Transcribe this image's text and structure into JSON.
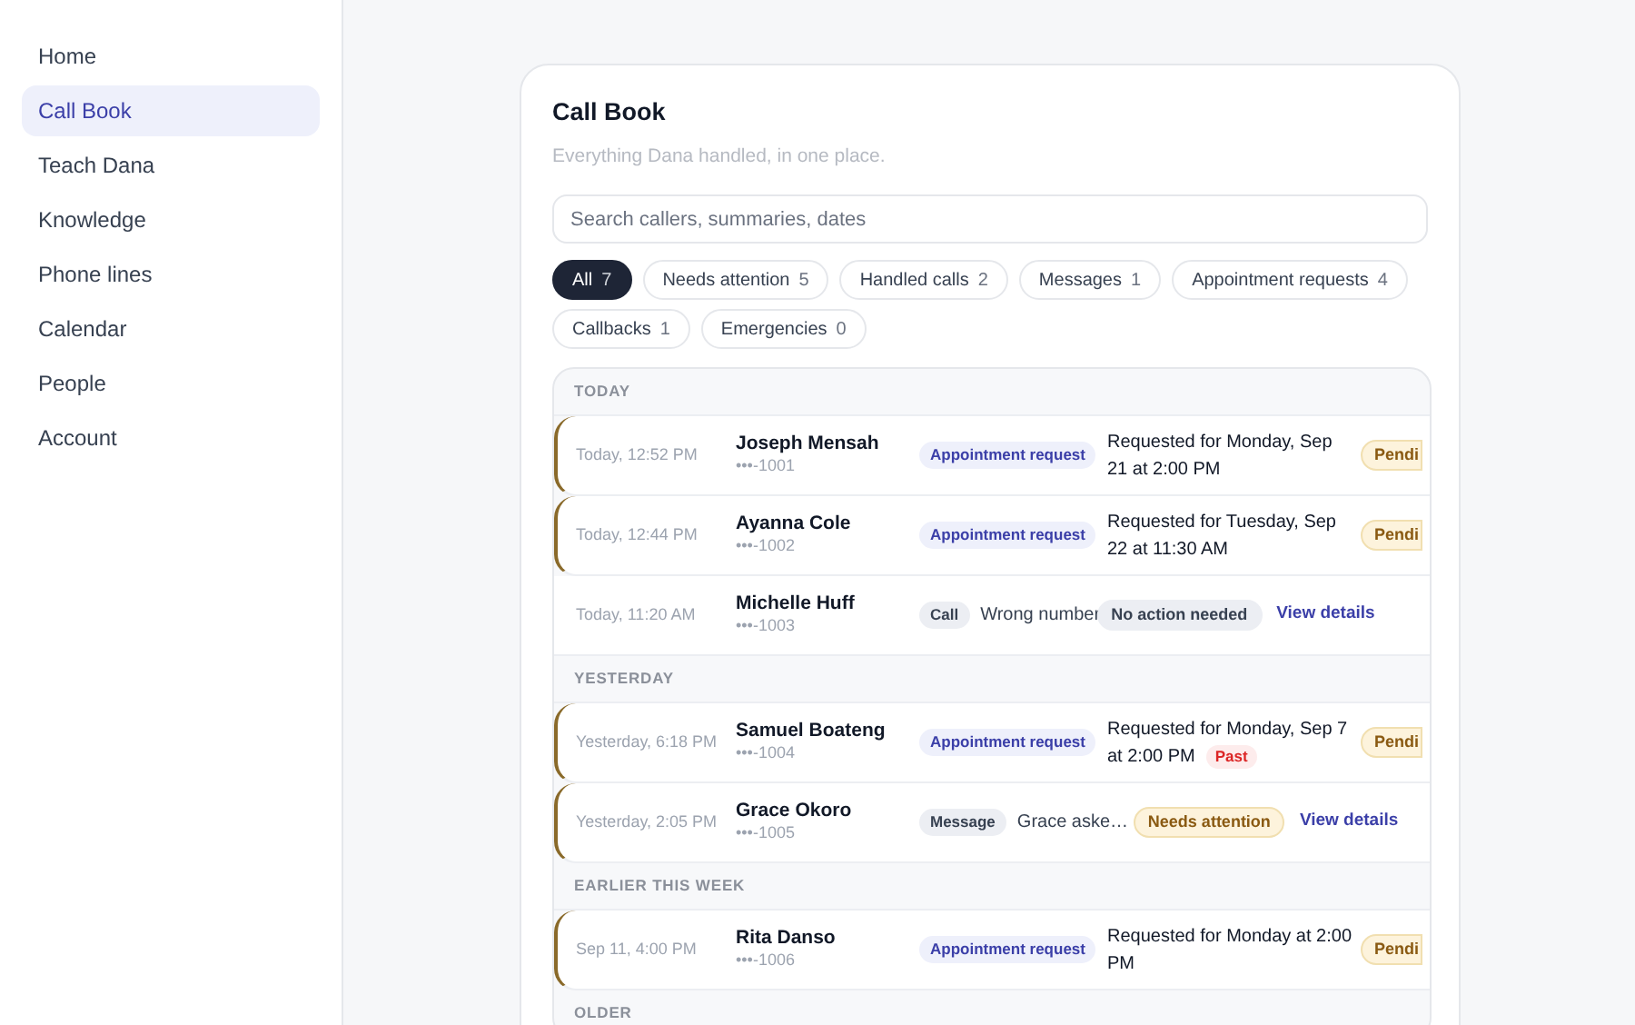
{
  "sidebar": {
    "items": [
      {
        "label": "Home",
        "selected": false
      },
      {
        "label": "Call Book",
        "selected": true
      },
      {
        "label": "Teach Dana",
        "selected": false
      },
      {
        "label": "Knowledge",
        "selected": false
      },
      {
        "label": "Phone lines",
        "selected": false
      },
      {
        "label": "Calendar",
        "selected": false
      },
      {
        "label": "People",
        "selected": false
      },
      {
        "label": "Account",
        "selected": false
      }
    ]
  },
  "page": {
    "title": "Call Book",
    "subtitle": "Everything Dana handled, in one place.",
    "search": {
      "placeholder": "Search callers, summaries, dates"
    }
  },
  "filters": [
    {
      "label": "All",
      "count": "7",
      "selected": true
    },
    {
      "label": "Needs attention",
      "count": "5",
      "selected": false
    },
    {
      "label": "Handled calls",
      "count": "2",
      "selected": false
    },
    {
      "label": "Messages",
      "count": "1",
      "selected": false
    },
    {
      "label": "Appointment requests",
      "count": "4",
      "selected": false
    },
    {
      "label": "Callbacks",
      "count": "1",
      "selected": false
    },
    {
      "label": "Emergencies",
      "count": "0",
      "selected": false
    }
  ],
  "groups": [
    {
      "heading": "TODAY",
      "rows": [
        {
          "kind": "appointment",
          "flagged": true,
          "time": "Today, 12:52 PM",
          "name": "Joseph Mensah",
          "phone": "•••-1001",
          "tag": "Appointment request",
          "summary": "Requested for Monday, Sep 21 at 2:00 PM",
          "status": "Pendi"
        },
        {
          "kind": "appointment",
          "flagged": true,
          "time": "Today, 12:44 PM",
          "name": "Ayanna Cole",
          "phone": "•••-1002",
          "tag": "Appointment request",
          "summary": "Requested for Tuesday, Sep 22 at 11:30 AM",
          "status": "Pendi"
        },
        {
          "kind": "call",
          "flagged": false,
          "time": "Today, 11:20 AM",
          "name": "Michelle Huff",
          "phone": "•••-1003",
          "tag": "Call",
          "summary": "Wrong number",
          "status": "No action needed",
          "link": "View details"
        }
      ]
    },
    {
      "heading": "YESTERDAY",
      "rows": [
        {
          "kind": "appointment",
          "flagged": true,
          "time": "Yesterday, 6:18 PM",
          "name": "Samuel Boateng",
          "phone": "•••-1004",
          "tag": "Appointment request",
          "summary": "Requested for Monday, Sep 7",
          "summary_line2": "at 2:00 PM",
          "past": "Past",
          "status": "Pendi"
        },
        {
          "kind": "call",
          "flagged": true,
          "time": "Yesterday, 2:05 PM",
          "name": "Grace Okoro",
          "phone": "•••-1005",
          "tag": "Message",
          "summary": "Grace aske…",
          "status": "Needs attention",
          "link": "View details"
        }
      ]
    },
    {
      "heading": "EARLIER THIS WEEK",
      "rows": [
        {
          "kind": "appointment",
          "flagged": true,
          "time": "Sep 11, 4:00 PM",
          "name": "Rita Danso",
          "phone": "•••-1006",
          "tag": "Appointment request",
          "summary": "Requested for Monday at 2:00 PM",
          "status": "Pendi"
        }
      ]
    },
    {
      "heading": "OLDER"
    }
  ]
}
